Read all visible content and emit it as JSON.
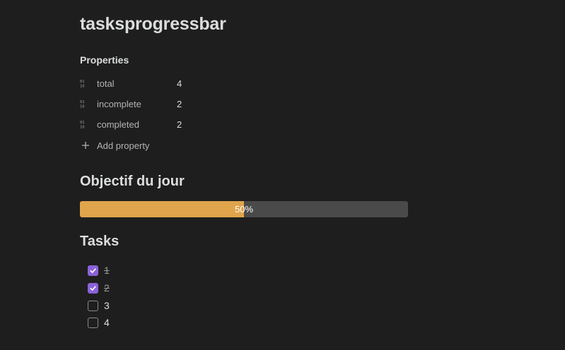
{
  "title": "tasksprogressbar",
  "properties": {
    "header": "Properties",
    "items": [
      {
        "icon": "number-property-icon",
        "key": "total",
        "value": "4"
      },
      {
        "icon": "number-property-icon",
        "key": "incomplete",
        "value": "2"
      },
      {
        "icon": "number-property-icon",
        "key": "completed",
        "value": "2"
      }
    ],
    "add_label": "Add property"
  },
  "objective": {
    "heading": "Objectif du jour",
    "progress_fraction": 0.5,
    "progress_label": "50%",
    "fill_color": "#e0a44c",
    "track_color": "#4a4a4a"
  },
  "tasks": {
    "heading": "Tasks",
    "items": [
      {
        "label": "1",
        "checked": true
      },
      {
        "label": "2",
        "checked": true
      },
      {
        "label": "3",
        "checked": false
      },
      {
        "label": "4",
        "checked": false
      }
    ],
    "check_color": "#8b62d8"
  }
}
